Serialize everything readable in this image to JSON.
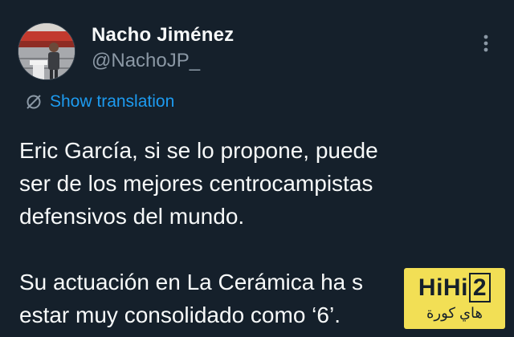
{
  "tweet": {
    "author": {
      "display_name": "Nacho Jiménez",
      "handle": "@NachoJP_",
      "avatar_icon": "profile-photo"
    },
    "more_icon": "more-vertical-icon",
    "translation": {
      "icon": "translate-icon",
      "label": "Show translation"
    },
    "paragraphs": [
      "Eric García, si se lo propone, puede\nser de los mejores centrocampistas\ndefensivos del mundo.",
      "Su actuación en La Cerámica ha s\nestar muy consolidado como ‘6’."
    ]
  },
  "watermark": {
    "logo": "HiHi",
    "logo_digit": "2",
    "subtitle": "هاي كورة",
    "color": "#f2df55"
  },
  "colors": {
    "background": "#15202b",
    "text": "#f7f9f9",
    "secondary": "#8b98a5",
    "accent": "#1d9bf0"
  }
}
